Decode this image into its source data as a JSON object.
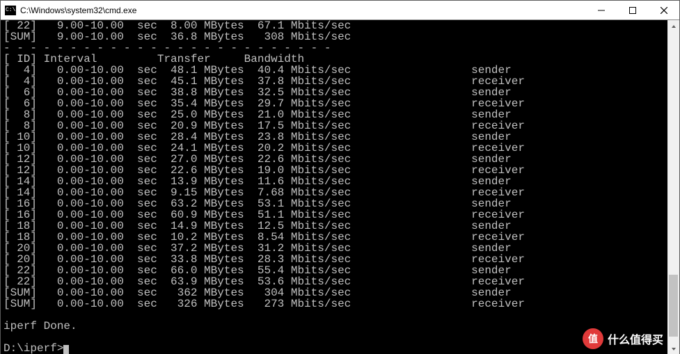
{
  "window": {
    "title": "C:\\Windows\\system32\\cmd.exe"
  },
  "terminal": {
    "top_rows": [
      {
        "id": " 22",
        "interval": " 9.00-10.00",
        "unit": "sec",
        "transfer": "8.00 MBytes",
        "bandwidth": "67.1 Mbits/sec"
      },
      {
        "id": "SUM",
        "interval": " 9.00-10.00",
        "unit": "sec",
        "transfer": "36.8 MBytes",
        "bandwidth": " 308 Mbits/sec"
      }
    ],
    "dashes": "- - - - - - - - - - - - - - - - - - - - - - - - -",
    "header": {
      "id": " ID",
      "interval": "Interval",
      "transfer": "Transfer",
      "bandwidth": "Bandwidth"
    },
    "rows": [
      {
        "id": "  4",
        "interval": " 0.00-10.00",
        "unit": "sec",
        "transfer": "48.1 MBytes",
        "bandwidth": "40.4 Mbits/sec",
        "role": "sender"
      },
      {
        "id": "  4",
        "interval": " 0.00-10.00",
        "unit": "sec",
        "transfer": "45.1 MBytes",
        "bandwidth": "37.8 Mbits/sec",
        "role": "receiver"
      },
      {
        "id": "  6",
        "interval": " 0.00-10.00",
        "unit": "sec",
        "transfer": "38.8 MBytes",
        "bandwidth": "32.5 Mbits/sec",
        "role": "sender"
      },
      {
        "id": "  6",
        "interval": " 0.00-10.00",
        "unit": "sec",
        "transfer": "35.4 MBytes",
        "bandwidth": "29.7 Mbits/sec",
        "role": "receiver"
      },
      {
        "id": "  8",
        "interval": " 0.00-10.00",
        "unit": "sec",
        "transfer": "25.0 MBytes",
        "bandwidth": "21.0 Mbits/sec",
        "role": "sender"
      },
      {
        "id": "  8",
        "interval": " 0.00-10.00",
        "unit": "sec",
        "transfer": "20.9 MBytes",
        "bandwidth": "17.5 Mbits/sec",
        "role": "receiver"
      },
      {
        "id": " 10",
        "interval": " 0.00-10.00",
        "unit": "sec",
        "transfer": "28.4 MBytes",
        "bandwidth": "23.8 Mbits/sec",
        "role": "sender"
      },
      {
        "id": " 10",
        "interval": " 0.00-10.00",
        "unit": "sec",
        "transfer": "24.1 MBytes",
        "bandwidth": "20.2 Mbits/sec",
        "role": "receiver"
      },
      {
        "id": " 12",
        "interval": " 0.00-10.00",
        "unit": "sec",
        "transfer": "27.0 MBytes",
        "bandwidth": "22.6 Mbits/sec",
        "role": "sender"
      },
      {
        "id": " 12",
        "interval": " 0.00-10.00",
        "unit": "sec",
        "transfer": "22.6 MBytes",
        "bandwidth": "19.0 Mbits/sec",
        "role": "receiver"
      },
      {
        "id": " 14",
        "interval": " 0.00-10.00",
        "unit": "sec",
        "transfer": "13.9 MBytes",
        "bandwidth": "11.6 Mbits/sec",
        "role": "sender"
      },
      {
        "id": " 14",
        "interval": " 0.00-10.00",
        "unit": "sec",
        "transfer": "9.15 MBytes",
        "bandwidth": "7.68 Mbits/sec",
        "role": "receiver"
      },
      {
        "id": " 16",
        "interval": " 0.00-10.00",
        "unit": "sec",
        "transfer": "63.2 MBytes",
        "bandwidth": "53.1 Mbits/sec",
        "role": "sender"
      },
      {
        "id": " 16",
        "interval": " 0.00-10.00",
        "unit": "sec",
        "transfer": "60.9 MBytes",
        "bandwidth": "51.1 Mbits/sec",
        "role": "receiver"
      },
      {
        "id": " 18",
        "interval": " 0.00-10.00",
        "unit": "sec",
        "transfer": "14.9 MBytes",
        "bandwidth": "12.5 Mbits/sec",
        "role": "sender"
      },
      {
        "id": " 18",
        "interval": " 0.00-10.00",
        "unit": "sec",
        "transfer": "10.2 MBytes",
        "bandwidth": "8.54 Mbits/sec",
        "role": "receiver"
      },
      {
        "id": " 20",
        "interval": " 0.00-10.00",
        "unit": "sec",
        "transfer": "37.2 MBytes",
        "bandwidth": "31.2 Mbits/sec",
        "role": "sender"
      },
      {
        "id": " 20",
        "interval": " 0.00-10.00",
        "unit": "sec",
        "transfer": "33.8 MBytes",
        "bandwidth": "28.3 Mbits/sec",
        "role": "receiver"
      },
      {
        "id": " 22",
        "interval": " 0.00-10.00",
        "unit": "sec",
        "transfer": "66.0 MBytes",
        "bandwidth": "55.4 Mbits/sec",
        "role": "sender"
      },
      {
        "id": " 22",
        "interval": " 0.00-10.00",
        "unit": "sec",
        "transfer": "63.9 MBytes",
        "bandwidth": "53.6 Mbits/sec",
        "role": "receiver"
      },
      {
        "id": "SUM",
        "interval": " 0.00-10.00",
        "unit": "sec",
        "transfer": " 362 MBytes",
        "bandwidth": " 304 Mbits/sec",
        "role": "sender"
      },
      {
        "id": "SUM",
        "interval": " 0.00-10.00",
        "unit": "sec",
        "transfer": " 326 MBytes",
        "bandwidth": " 273 Mbits/sec",
        "role": "receiver"
      }
    ],
    "done": "iperf Done.",
    "prompt": "D:\\iperf>"
  },
  "watermark": {
    "badge": "值",
    "text": "什么值得买"
  }
}
